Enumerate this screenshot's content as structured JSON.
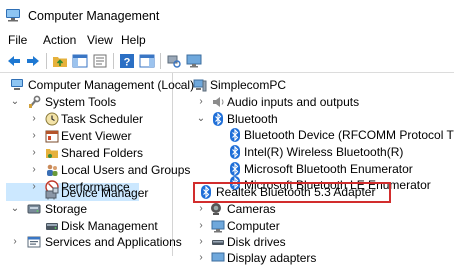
{
  "window": {
    "title": "Computer Management"
  },
  "menu": [
    "File",
    "Action",
    "View",
    "Help"
  ],
  "toolbar_icons": [
    "back-arrow-icon",
    "forward-arrow-icon",
    "up-folder-icon",
    "show-hide-tree-icon",
    "properties-icon",
    "help-icon",
    "action-pane-icon",
    "scan-hardware-icon",
    "monitor-icon"
  ],
  "left_tree": [
    {
      "label": "Computer Management (Local)",
      "icon": "computer-management-icon",
      "expanded": true
    },
    {
      "label": "System Tools",
      "icon": "tools-icon",
      "expanded": true
    },
    {
      "label": "Task Scheduler",
      "icon": "clock-icon",
      "expanded": false
    },
    {
      "label": "Event Viewer",
      "icon": "event-viewer-icon",
      "expanded": false
    },
    {
      "label": "Shared Folders",
      "icon": "shared-folder-icon",
      "expanded": false
    },
    {
      "label": "Local Users and Groups",
      "icon": "users-icon",
      "expanded": false
    },
    {
      "label": "Performance",
      "icon": "performance-icon",
      "expanded": false
    },
    {
      "label": "Device Manager",
      "icon": "device-manager-icon",
      "selected": true
    },
    {
      "label": "Storage",
      "icon": "storage-icon",
      "expanded": true
    },
    {
      "label": "Disk Management",
      "icon": "disk-management-icon"
    },
    {
      "label": "Services and Applications",
      "icon": "services-icon",
      "expanded": false
    }
  ],
  "right_tree": [
    {
      "label": "SimplecomPC",
      "icon": "computer-icon",
      "expanded": true
    },
    {
      "label": "Audio inputs and outputs",
      "icon": "speaker-icon",
      "expanded": false
    },
    {
      "label": "Bluetooth",
      "icon": "bluetooth-icon",
      "expanded": true
    },
    {
      "label": "Bluetooth Device (RFCOMM Protocol TDI)",
      "icon": "bluetooth-icon"
    },
    {
      "label": "Intel(R) Wireless Bluetooth(R)",
      "icon": "bluetooth-icon"
    },
    {
      "label": "Microsoft Bluetooth Enumerator",
      "icon": "bluetooth-icon"
    },
    {
      "label": "Microsoft Bluetooth LE Enumerator",
      "icon": "bluetooth-icon"
    },
    {
      "label": "Realtek Bluetooth 5.3 Adapter",
      "icon": "bluetooth-icon",
      "highlighted": true
    },
    {
      "label": "Cameras",
      "icon": "camera-icon",
      "expanded": false
    },
    {
      "label": "Computer",
      "icon": "computer-icon",
      "expanded": false
    },
    {
      "label": "Disk drives",
      "icon": "disk-drive-icon",
      "expanded": false
    },
    {
      "label": "Display adapters",
      "icon": "display-adapter-icon",
      "expanded": false
    }
  ],
  "colors": {
    "selection": "#cce8ff",
    "highlight_border": "#d22d2d",
    "bluetooth": "#1f6fd8"
  }
}
